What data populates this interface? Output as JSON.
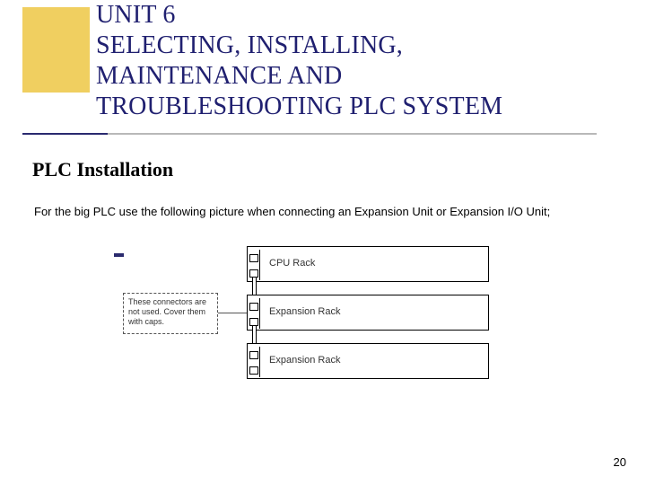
{
  "title": {
    "line1": "UNIT 6",
    "line2": "SELECTING, INSTALLING,",
    "line3": "MAINTENANCE AND",
    "line4": "TROUBLESHOOTING PLC SYSTEM"
  },
  "subhead": "PLC Installation",
  "body": "For the big PLC use the following picture when connecting an Expansion Unit or Expansion I/O Unit;",
  "diagram": {
    "callout": "These connectors are not used. Cover them with caps.",
    "racks": {
      "r0": "CPU Rack",
      "r1": "Expansion Rack",
      "r2": "Expansion Rack"
    }
  },
  "page_number": "20"
}
